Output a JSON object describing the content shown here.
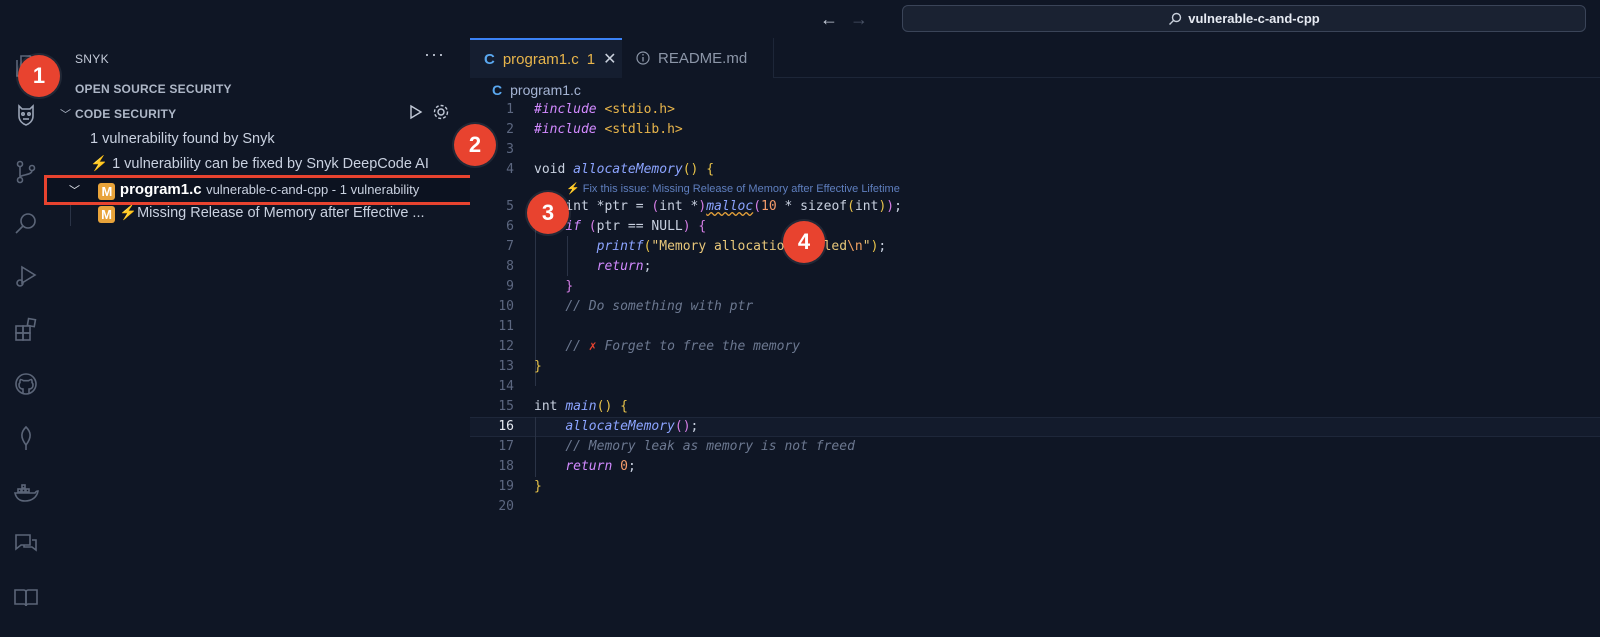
{
  "titlebar": {
    "back_icon": "arrow-left-icon",
    "forward_icon": "arrow-right-icon",
    "search_text": "vulnerable-c-and-cpp"
  },
  "sidebar": {
    "title": "SNYK",
    "more_icon": "ellipsis-icon",
    "open_source_label": "OPEN SOURCE SECURITY",
    "code_security_label": "CODE SECURITY",
    "summary_1": "1 vulnerability found by Snyk",
    "summary_2": "⚡ 1 vulnerability can be fixed by Snyk DeepCode AI",
    "file_badge": "M",
    "file_name": "program1.c",
    "file_desc": "vulnerable-c-and-cpp - 1 vulnerability",
    "issue_badge": "M",
    "issue_label": "⚡Missing Release of Memory after Effective ..."
  },
  "tabs": {
    "active": {
      "icon": "C",
      "label": "program1.c",
      "count": "1"
    },
    "readme": {
      "label": "README.md"
    }
  },
  "breadcrumb": {
    "icon": "C",
    "label": "program1.c"
  },
  "editor": {
    "hint": "⚡ Fix this issue: Missing Release of Memory after Effective Lifetime",
    "current_line": 16
  },
  "callouts": [
    "1",
    "2",
    "3",
    "4"
  ],
  "colors": {
    "background": "#0f1625",
    "accent": "#3b82f6",
    "callout": "#e8432f",
    "badge": "#e8a33a"
  }
}
